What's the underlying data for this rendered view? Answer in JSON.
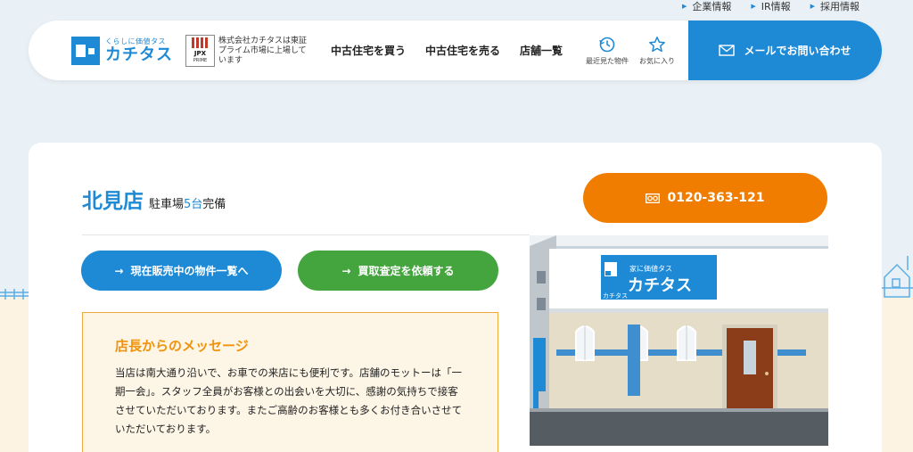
{
  "top_links": [
    "企業情報",
    "IR情報",
    "採用情報"
  ],
  "logo": {
    "tagline": "くらしに価値タス",
    "name": "カチタス"
  },
  "jpx": {
    "line1": "JPX",
    "line2": "PRIME"
  },
  "listing_text": "株式会社カチタスは東証プライム市場に上場しています",
  "nav": {
    "buy": "中古住宅を買う",
    "sell": "中古住宅を売る",
    "shops": "店舗一覧"
  },
  "icons": {
    "recent_label": "最近見た物件",
    "fav_label": "お気に入り"
  },
  "contact_button": "メールでお問い合わせ",
  "store": {
    "name": "北見店",
    "parking_prefix": "駐車場",
    "parking_count": "5台",
    "parking_suffix": "完備"
  },
  "phone": "0120-363-121",
  "buttons": {
    "listings": "現在販売中の物件一覧へ",
    "appraisal": "買取査定を依頼する"
  },
  "message": {
    "title": "店長からのメッセージ",
    "body": "当店は南大通り沿いで、お車での来店にも便利です。店舗のモットーは「一期一会」。スタッフ全員がお客様との出会いを大切に、感謝の気持ちで接客させていただいております。またご高齢のお客様とも多くお付き合いさせていただいております。"
  },
  "photo_sign": {
    "tagline": "家に価値タス",
    "name": "カチタス",
    "small": "カチタス"
  },
  "colors": {
    "brand_blue": "#1e8ad6",
    "orange": "#f07d00",
    "green": "#44a53e",
    "message_title": "#f0930b"
  }
}
